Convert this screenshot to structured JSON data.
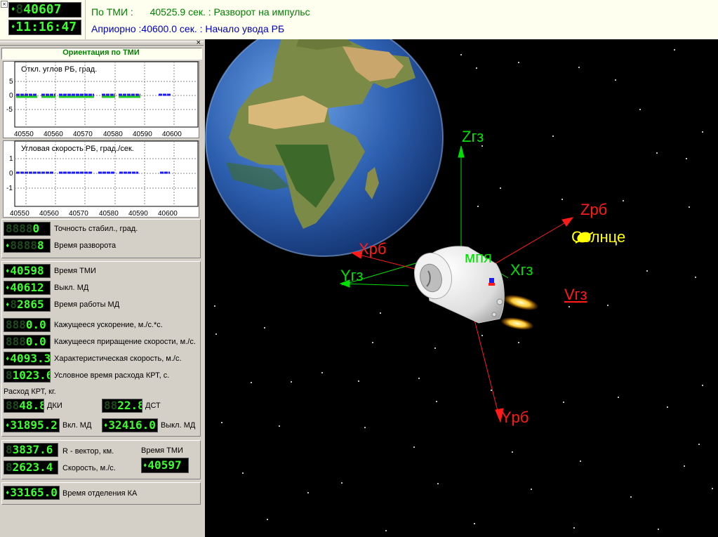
{
  "header": {
    "counter_main": "40607",
    "counter_time": "11:16:47",
    "line1_label": "По ТМИ :",
    "line1_value": "40525.9 сек. : Разворот на импульс",
    "line2_label": "Априорно :",
    "line2_value": "40600.0 сек. : Начало увода РБ"
  },
  "sidebar": {
    "title": "Ориентация по ТМИ",
    "chart1": {
      "title": "Откл. углов РБ, град.",
      "y_ticks": [
        "5",
        "0",
        "-5"
      ],
      "x_ticks": [
        "40550",
        "40560",
        "40570",
        "40580",
        "40590",
        "40600"
      ]
    },
    "chart2": {
      "title": "Угловая скорость РБ, град./сек.",
      "y_ticks": [
        "1",
        "0",
        "-1"
      ],
      "x_ticks": [
        "40550",
        "40560",
        "40570",
        "40580",
        "40590",
        "40600"
      ]
    },
    "group1": [
      {
        "value": "0",
        "ghost": "8888",
        "label": "Точность стабил., град."
      },
      {
        "value": "8",
        "ghost": "8888",
        "label": "Время разворота"
      }
    ],
    "group2": [
      {
        "value": "40598",
        "ghost": "",
        "label": "Время ТМИ"
      },
      {
        "value": "40612",
        "ghost": "",
        "label": "Выкл. МД"
      },
      {
        "value": "2865",
        "ghost": "8",
        "label": "Время работы МД"
      },
      {
        "value": "0.0",
        "ghost": "888",
        "label": "Кажущееся ускорение, м./с.*с."
      },
      {
        "value": "0.0",
        "ghost": "888",
        "label": "Кажущееся приращение скорости, м./с."
      },
      {
        "value": "4093.3",
        "ghost": "",
        "label": "Характеристическая скорость, м./с."
      },
      {
        "value": "1023.6",
        "ghost": "8",
        "label": "Условное время расхода КРТ, с."
      }
    ],
    "fuel": {
      "title": "Расход КРТ, кг.",
      "dki_value": "48.8",
      "dki_label": "ДКИ",
      "dst_value": "22.8",
      "dst_label": "ДСТ",
      "on_value": "31895.2",
      "on_label": "Вкл. МД",
      "off_value": "32416.0",
      "off_label": "Выкл. МД"
    },
    "group3": {
      "r_value": "3837.6",
      "r_label": "R - вектор, км.",
      "v_value": "2623.4",
      "v_label": "Скорость, м./с.",
      "tmi_title": "Время ТМИ",
      "tmi_value": "40597"
    },
    "group4": {
      "sep_value": "33165.0",
      "sep_label": "Время отделения КА"
    }
  },
  "scene": {
    "labels": {
      "zgz": "Zгз",
      "ygz": "Yгз",
      "xgz": "Xгз",
      "vgz": "Vгз",
      "zrb": "Zрб",
      "xrb": "Xрб",
      "yrb": "Yрб",
      "sun": "Солнце",
      "mpya": "мпя"
    }
  },
  "colors": {
    "green_axes": "#00e000",
    "red_axes": "#ff1a1a",
    "sun": "#ffff00",
    "header_green": "#008000",
    "header_blue": "#0000c0",
    "lcd_green": "#3cff2e"
  }
}
